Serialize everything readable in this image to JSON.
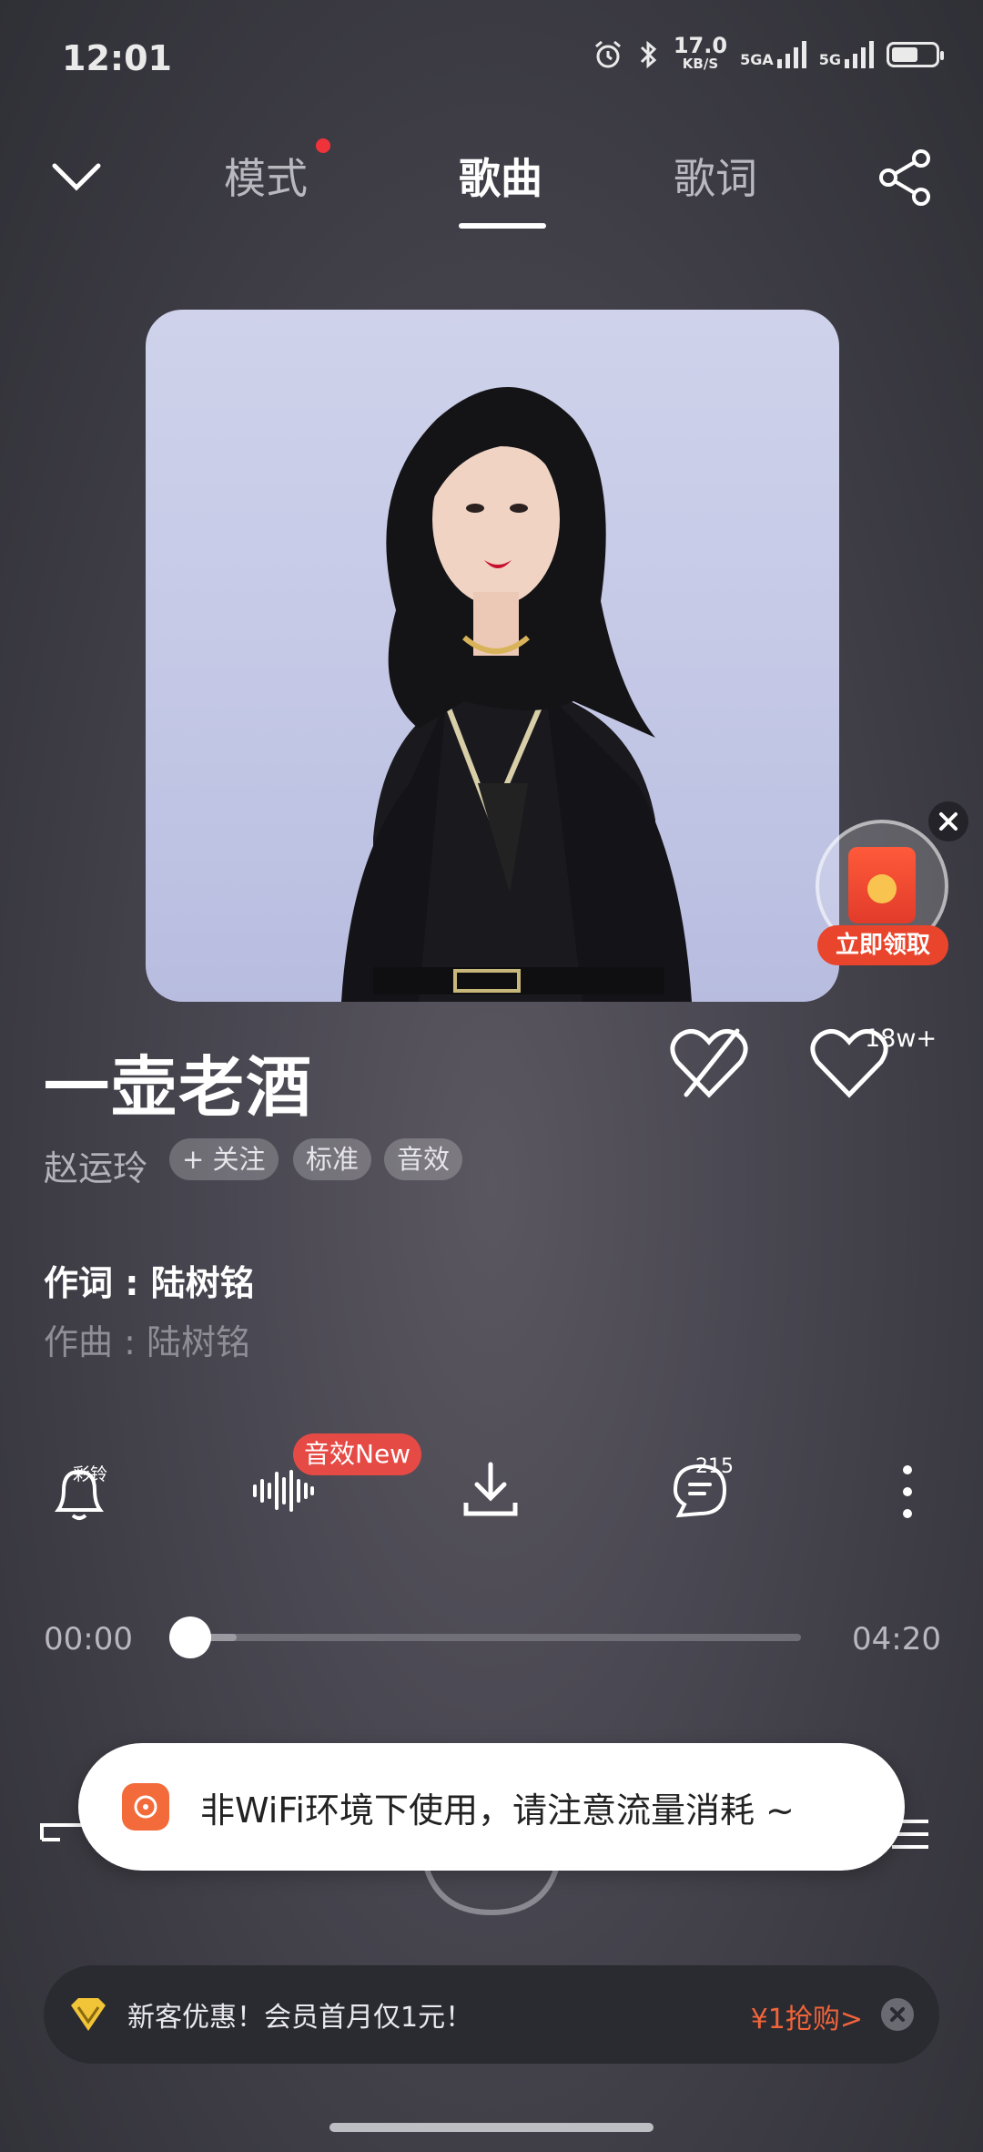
{
  "status_bar": {
    "time": "12:01",
    "net_speed_value": "17.0",
    "net_speed_unit": "KB/S",
    "signal1_label": "5GA",
    "signal2_label": "5G",
    "battery_level": 0.6
  },
  "header": {
    "tabs": [
      {
        "label": "模式",
        "has_dot": true
      },
      {
        "label": "歌曲",
        "active": true
      },
      {
        "label": "歌词"
      }
    ]
  },
  "song": {
    "title": "一壶老酒",
    "artist": "赵运玲",
    "follow_label": "+ 关注",
    "quality_label": "标准",
    "effect_label": "音效",
    "like_count": "18w+",
    "lyricist": "作词 : 陆树铭",
    "composer": "作曲 : 陆树铭"
  },
  "actions": {
    "ringtone_label": "彩铃",
    "effect_badge": "音效New",
    "comment_count": "215"
  },
  "progress": {
    "current": "00:00",
    "total": "04:20",
    "fraction": 0.0
  },
  "toast": {
    "text": "非WiFi环境下使用，请注意流量消耗 ~"
  },
  "float_promo": {
    "label": "立即领取"
  },
  "promo_bar": {
    "text": "新客优惠！会员首月仅1元！",
    "cta": "¥1抢购>"
  },
  "colors": {
    "accent_red": "#e64a45",
    "promo_orange": "#f0643a"
  }
}
